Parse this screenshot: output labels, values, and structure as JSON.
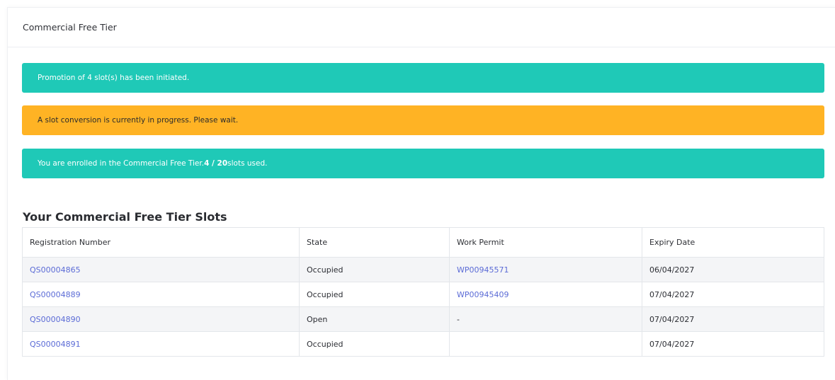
{
  "card": {
    "title": "Commercial Free Tier"
  },
  "alerts": {
    "promotion": "Promotion of 4 slot(s) has been initiated.",
    "conversion": "A slot conversion is currently in progress. Please wait.",
    "enrolled_prefix": "You are enrolled in the Commercial Free Tier.",
    "enrolled_count": "4 / 20",
    "enrolled_suffix": "slots used.",
    "colors": {
      "success": "#1fc9b7",
      "warning": "#ffb324"
    }
  },
  "slots": {
    "title": "Your Commercial Free Tier Slots",
    "columns": [
      "Registration Number",
      "State",
      "Work Permit",
      "Expiry Date"
    ],
    "rows": [
      {
        "registration": "QS00004865",
        "state": "Occupied",
        "work_permit": "WP00945571",
        "expiry": "06/04/2027"
      },
      {
        "registration": "QS00004889",
        "state": "Occupied",
        "work_permit": "WP00945409",
        "expiry": "07/04/2027"
      },
      {
        "registration": "QS00004890",
        "state": "Open",
        "work_permit": "-",
        "expiry": "07/04/2027"
      },
      {
        "registration": "QS00004891",
        "state": "Occupied",
        "work_permit": "",
        "expiry": "07/04/2027"
      }
    ],
    "link_color": "#5b6bd6"
  }
}
